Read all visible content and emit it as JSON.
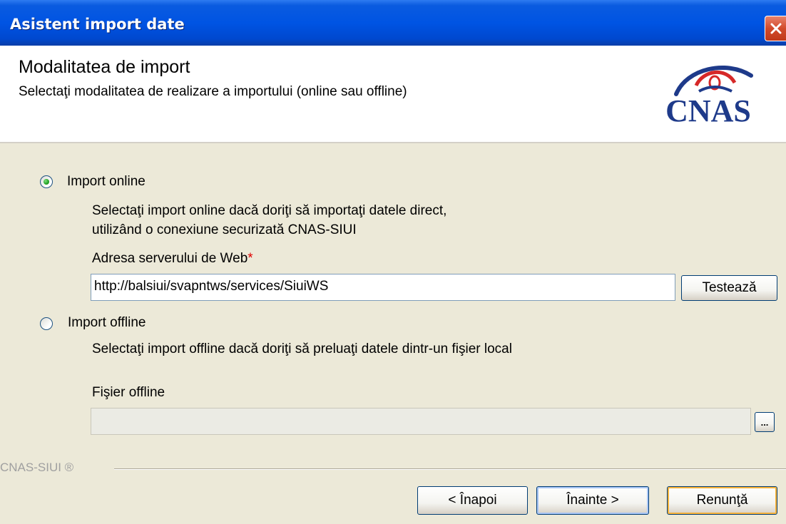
{
  "window": {
    "title": "Asistent import date"
  },
  "header": {
    "title": "Modalitatea de import",
    "subtitle": "Selectaţi modalitatea de realizare a importului (online sau offline)",
    "logo_text": "CNAS"
  },
  "online": {
    "label": "Import online",
    "selected": true,
    "description_line1": "Selectaţi import online dacă doriţi să importaţi datele direct,",
    "description_line2": " utilizând o conexiune securizată CNAS-SIUI",
    "server_label": "Adresa serverului de Web",
    "required_mark": "*",
    "server_value": "http://balsiui/svapntws/services/SiuiWS",
    "test_button": "Testează"
  },
  "offline": {
    "label": "Import offline",
    "selected": false,
    "description": "Selectaţi import offline dacă doriţi să preluaţi datele dintr-un fişier local",
    "file_label": "Fişier offline",
    "file_value": "",
    "browse_button": "..."
  },
  "footer": {
    "brand": "CNAS-SIUI ®",
    "back_button": "< Înapoi",
    "next_button": "Înainte >",
    "cancel_button": "Renunţă"
  },
  "colors": {
    "titlebar": "#0054E3",
    "dialog_bg": "#ECE9D8",
    "required": "#E00000",
    "logo_blue": "#1E3A8A",
    "logo_red": "#D62828"
  }
}
